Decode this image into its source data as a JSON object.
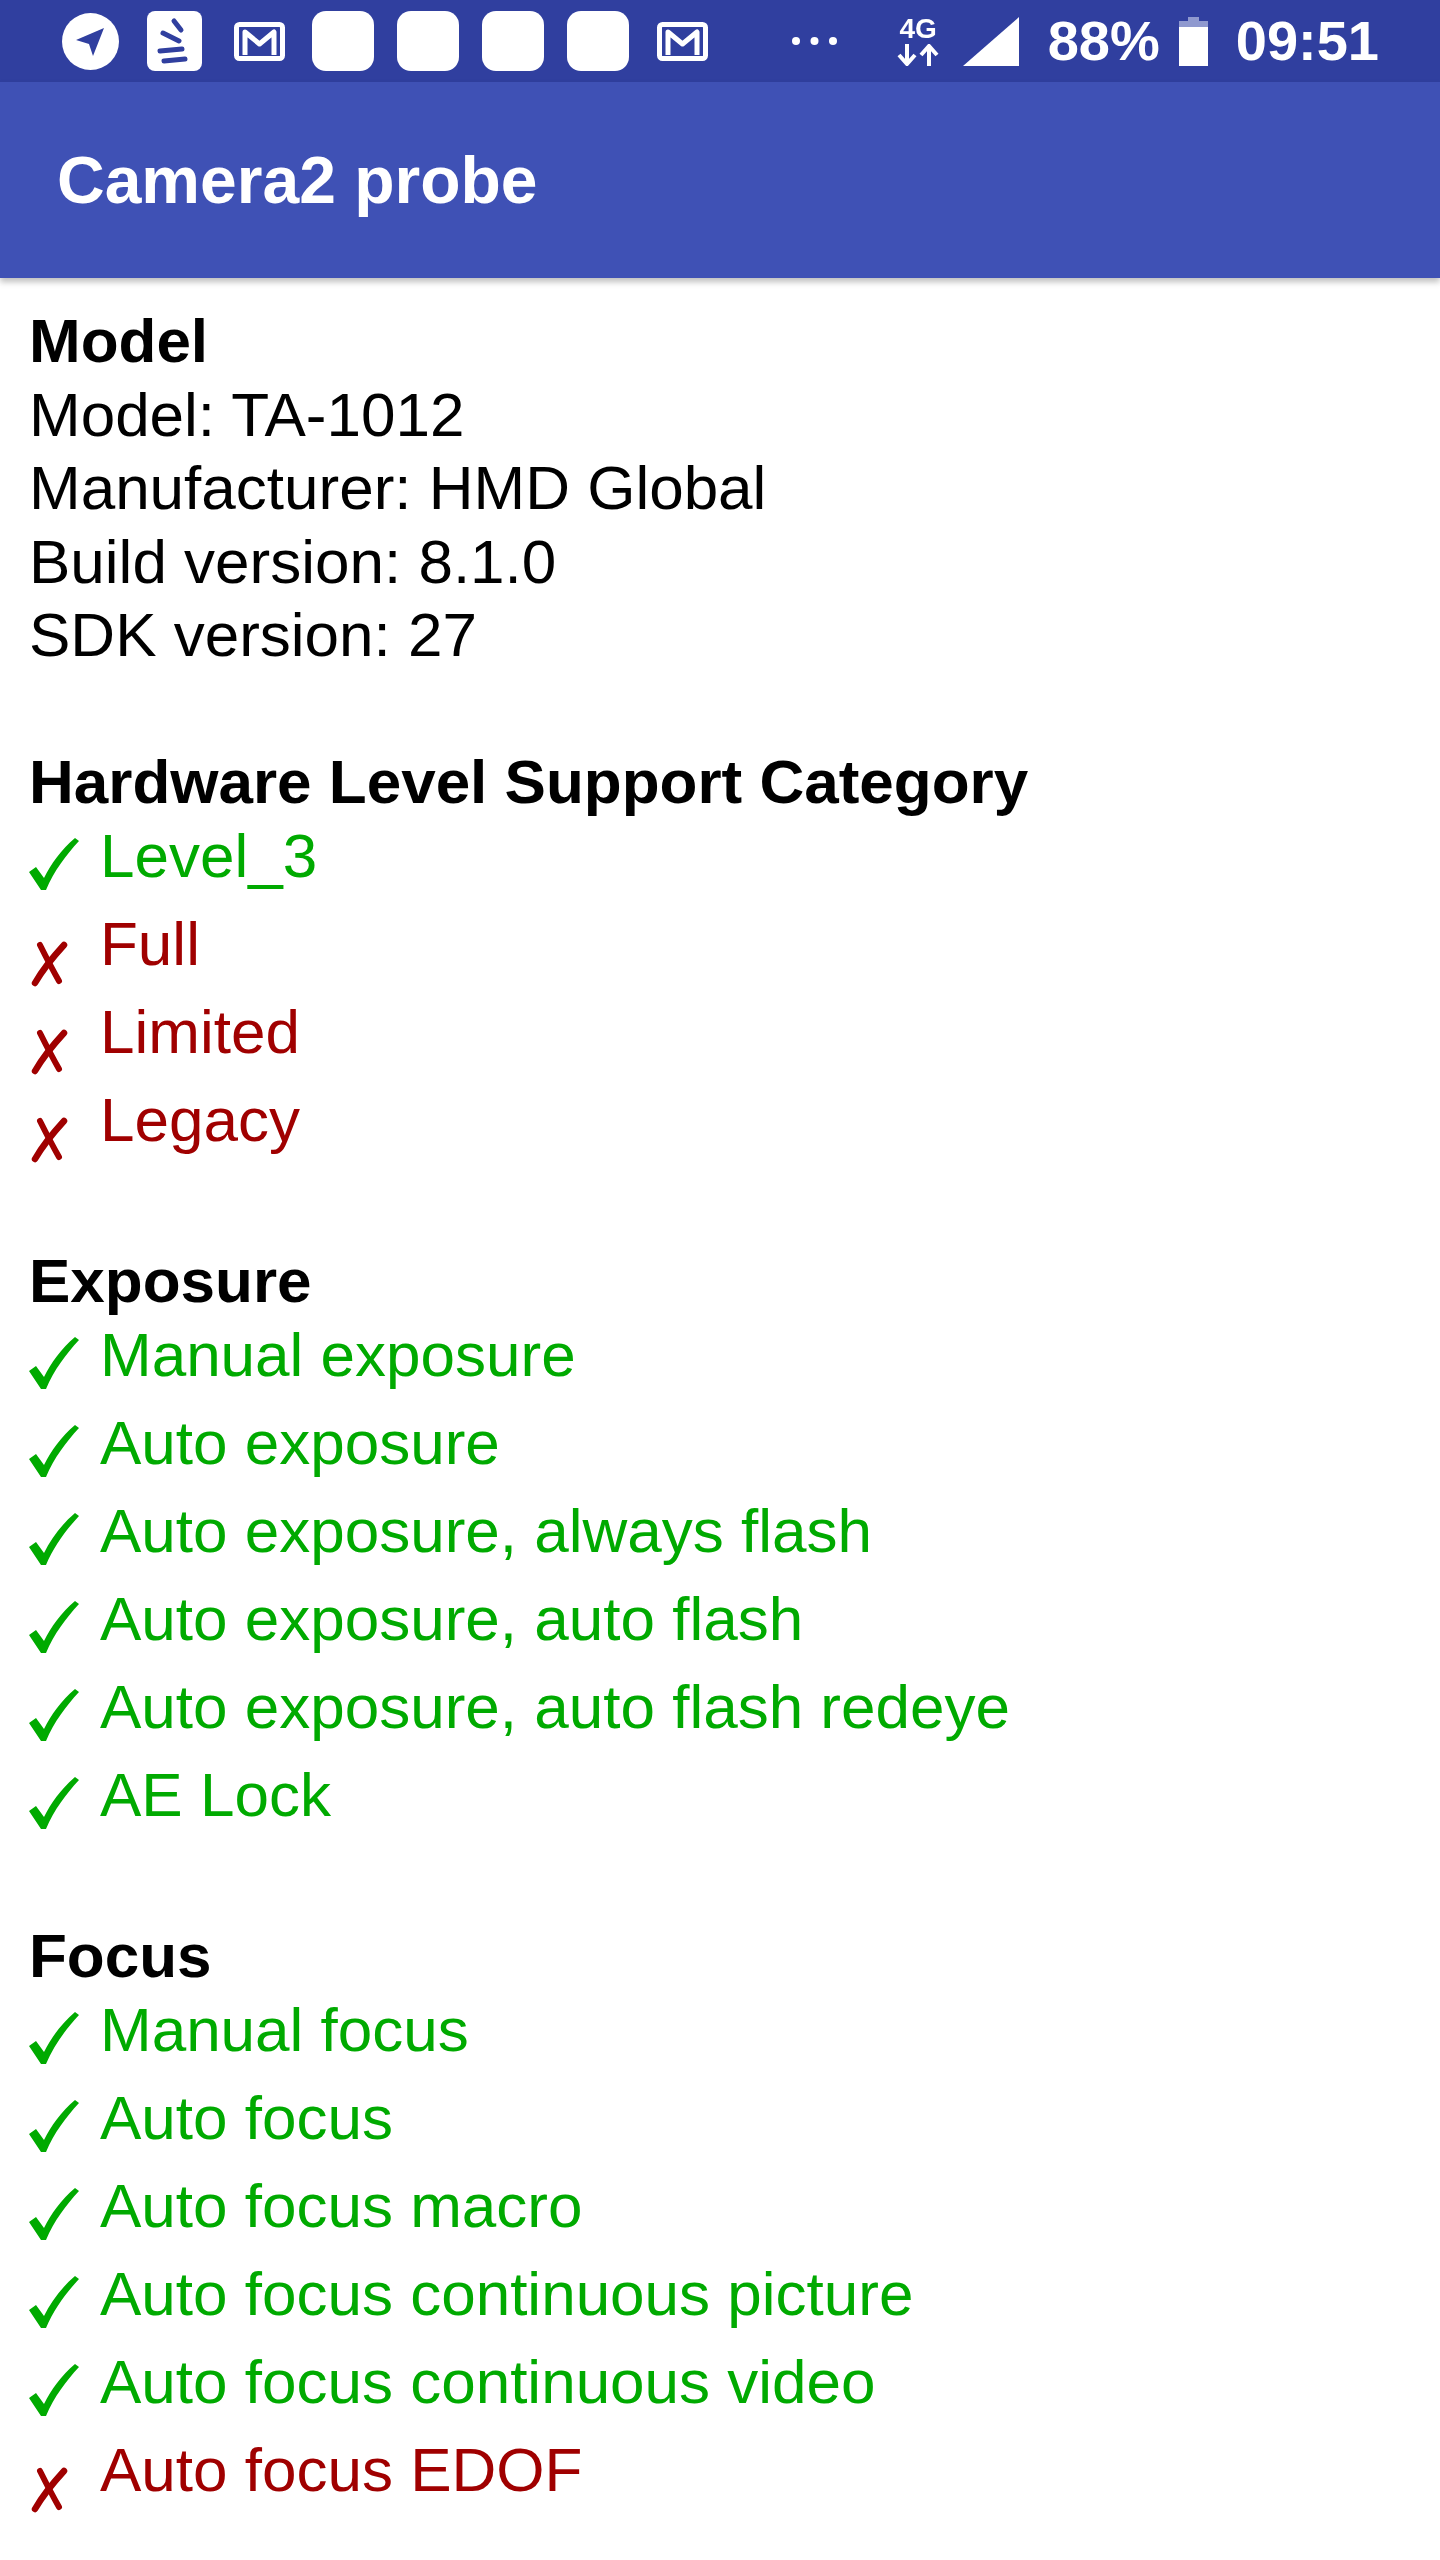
{
  "status_bar": {
    "network": "4G",
    "battery": "88%",
    "time": "09:51"
  },
  "toolbar": {
    "title": "Camera2 probe"
  },
  "sections": [
    {
      "kind": "info",
      "title": "Model",
      "lines": [
        "Model: TA-1012",
        "Manufacturer: HMD Global",
        "Build version: 8.1.0",
        "SDK version: 27"
      ]
    },
    {
      "kind": "checklist",
      "title": "Hardware Level Support Category",
      "features": [
        {
          "label": "Level_3",
          "supported": true
        },
        {
          "label": "Full",
          "supported": false
        },
        {
          "label": "Limited",
          "supported": false
        },
        {
          "label": "Legacy",
          "supported": false
        }
      ]
    },
    {
      "kind": "checklist",
      "title": "Exposure",
      "features": [
        {
          "label": "Manual exposure",
          "supported": true
        },
        {
          "label": "Auto exposure",
          "supported": true
        },
        {
          "label": "Auto exposure, always flash",
          "supported": true
        },
        {
          "label": "Auto exposure, auto flash",
          "supported": true
        },
        {
          "label": "Auto exposure, auto flash redeye",
          "supported": true
        },
        {
          "label": "AE Lock",
          "supported": true
        }
      ]
    },
    {
      "kind": "checklist",
      "title": "Focus",
      "features": [
        {
          "label": "Manual focus",
          "supported": true
        },
        {
          "label": "Auto focus",
          "supported": true
        },
        {
          "label": "Auto focus macro",
          "supported": true
        },
        {
          "label": "Auto focus continuous picture",
          "supported": true
        },
        {
          "label": "Auto focus continuous video",
          "supported": true
        },
        {
          "label": "Auto focus EDOF",
          "supported": false
        }
      ]
    }
  ]
}
